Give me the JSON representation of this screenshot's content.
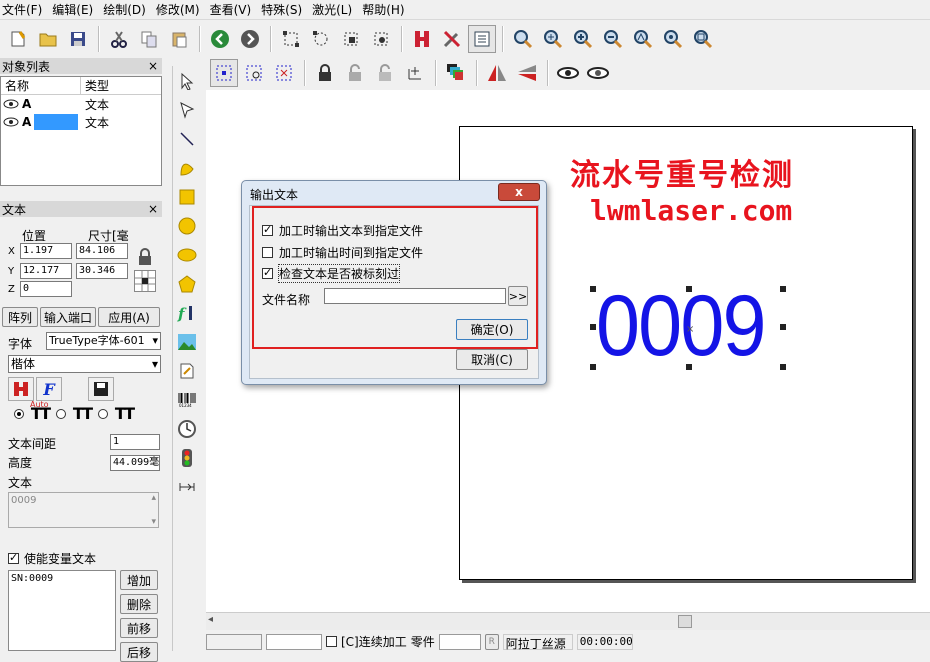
{
  "menu": [
    "文件(F)",
    "编辑(E)",
    "绘制(D)",
    "修改(M)",
    "查看(V)",
    "特殊(S)",
    "激光(L)",
    "帮助(H)"
  ],
  "object_list": {
    "title": "对象列表",
    "close": "×",
    "col_name": "名称",
    "col_type": "类型",
    "rows": [
      {
        "name": "A",
        "type": "文本"
      },
      {
        "name": "A",
        "type": "文本"
      }
    ]
  },
  "text_panel": {
    "title": "文本",
    "close": "×",
    "pos_label": "位置",
    "size_label": "尺寸[毫",
    "x_label": "X",
    "y_label": "Y",
    "z_label": "Z",
    "x_pos": "1.197",
    "y_pos": "12.177",
    "z_pos": "0",
    "x_size": "84.106",
    "y_size": "30.346",
    "array_btn": "阵列",
    "input_port_btn": "输入端口",
    "apply_btn": "应用(A)",
    "font_label": "字体",
    "font_type": "TrueType字体-601",
    "font_name": "楷体",
    "auto_label": "Auto",
    "spacing_label": "文本间距",
    "spacing_value": "1",
    "height_label": "高度",
    "height_value": "44.099毫",
    "text_label": "文本",
    "text_value": "0009",
    "variable_label": "使能变量文本",
    "variable_value": "SN:0009",
    "add_btn": "增加",
    "delete_btn": "删除",
    "prev_btn": "前移",
    "next_btn": "后移"
  },
  "canvas": {
    "title_text": "流水号重号检测",
    "url_text": "lwmlaser.com",
    "number_text": "0009",
    "red": "#e8141e",
    "blue": "#1414e6"
  },
  "dialog": {
    "title": "输出文本",
    "close": "x",
    "opt1": "加工时输出文本到指定文件",
    "opt2": "加工时输出时间到指定文件",
    "opt3": "检查文本是否被标刻过",
    "opt1_checked": true,
    "opt2_checked": false,
    "opt3_checked": true,
    "file_label": "文件名称",
    "file_value": "",
    "browse": ">>",
    "ok": "确定(O)",
    "cancel": "取消(C)"
  },
  "status": {
    "continuous": "[C]连续加工",
    "parts": "零件",
    "r_btn": "R",
    "font_status": "阿拉丁丝源",
    "time": "00:00:00"
  }
}
